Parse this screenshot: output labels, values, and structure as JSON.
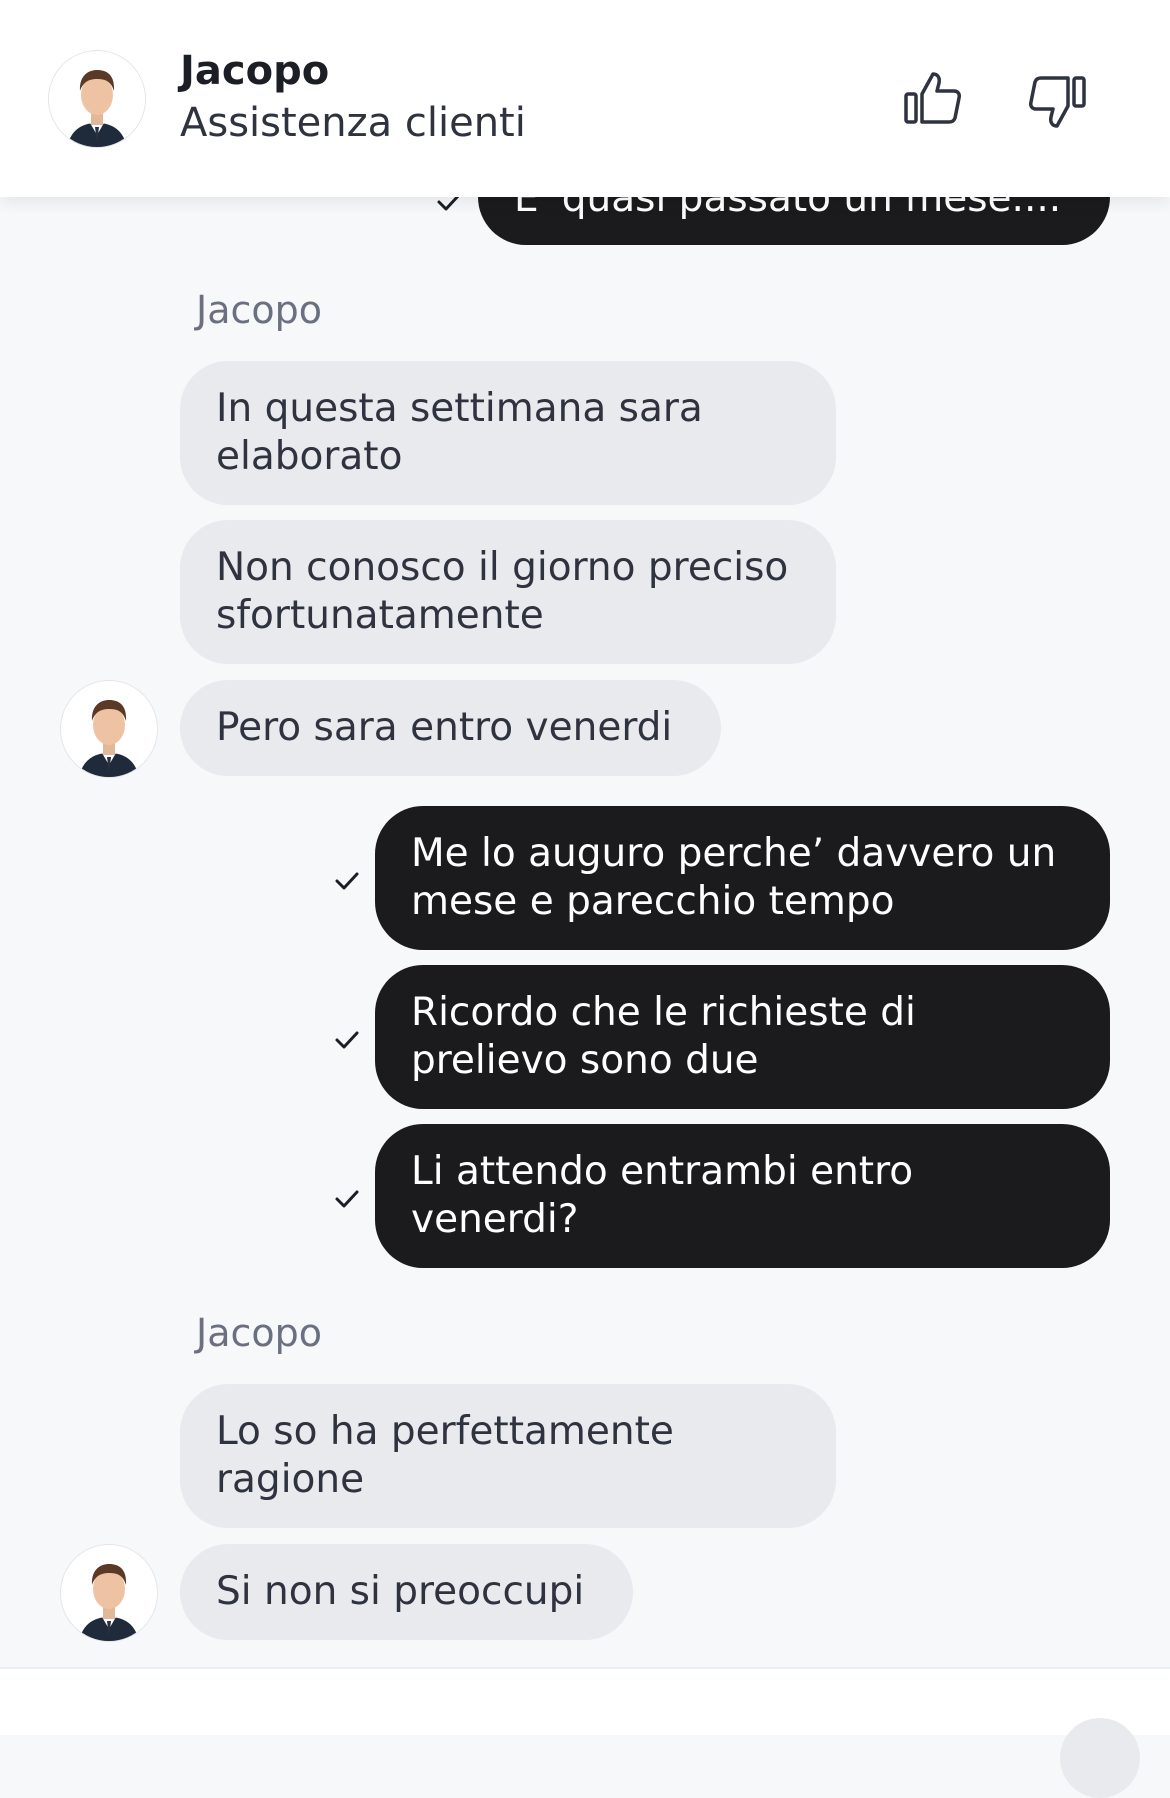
{
  "header": {
    "agent_name": "Jacopo",
    "agent_role": "Assistenza clienti",
    "thumbs_up_icon": "thumbs-up-icon",
    "thumbs_down_icon": "thumbs-down-icon"
  },
  "messages": {
    "top_partial": "E' quasi passato un mese....",
    "sender_1": "Jacopo",
    "in_1": "In questa settimana sara elaborato",
    "in_2": "Non conosco il giorno preciso sfortunatamente",
    "in_3": "Pero sara entro venerdi",
    "out_1": "Me lo auguro perche’ davvero un mese e parecchio tempo",
    "out_2": "Ricordo che le richieste di prelievo sono due",
    "out_3": "Li attendo entrambi entro venerdi?",
    "sender_2": "Jacopo",
    "in_4": "Lo so ha perfettamente ragione",
    "in_5": "Si non si preoccupi"
  },
  "colors": {
    "incoming_bubble": "#e9eaed",
    "outgoing_bubble": "#1b1b1d",
    "background": "#f7f8fa"
  }
}
